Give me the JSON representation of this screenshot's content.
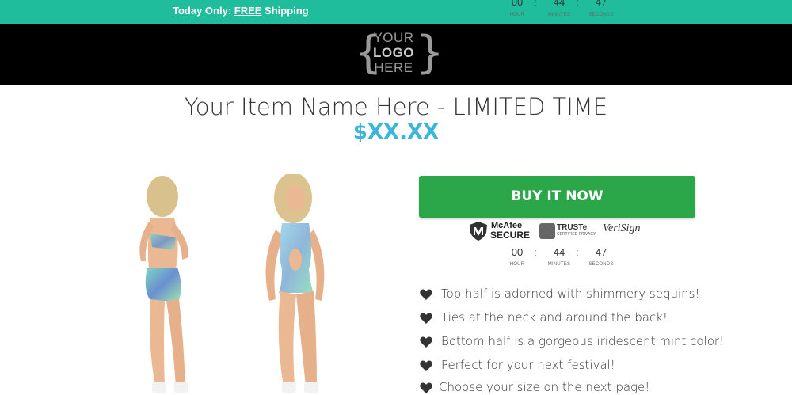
{
  "topbar": {
    "promo_prefix": "Today Only: ",
    "promo_link": "FREE",
    "promo_suffix": " Shipping",
    "background": "#20bd9c"
  },
  "countdown": {
    "hours": "00",
    "minutes": "44",
    "seconds": "47",
    "separator": ":",
    "hour_label": "HOUR",
    "minutes_label": "MINUTES",
    "seconds_label": "SECONDS"
  },
  "header": {
    "logo_lines": [
      "YOUR",
      "LOGO",
      "HERE"
    ]
  },
  "product": {
    "title": "Your Item Name Here - LIMITED TIME",
    "price": "$XX.XX",
    "price_color": "#3bb6d8"
  },
  "buy_button": {
    "label": "BUY IT NOW",
    "color": "#2ba74a"
  },
  "trust_badges": {
    "mcafee_line1": "McAfee",
    "mcafee_line2": "SECURE",
    "truste_line1": "TRUSTe",
    "truste_line2": "CERTIFIED PRIVACY",
    "verisign": "VeriSign"
  },
  "features": [
    "Top half is adorned with shimmery sequins!",
    "Ties at the neck and around the back!",
    "Bottom half is a gorgeous iridescent mint color!",
    "Perfect for your next festival!",
    "Choose your size on the next page!"
  ],
  "icons": {
    "feature_bullet": "heart-icon"
  }
}
